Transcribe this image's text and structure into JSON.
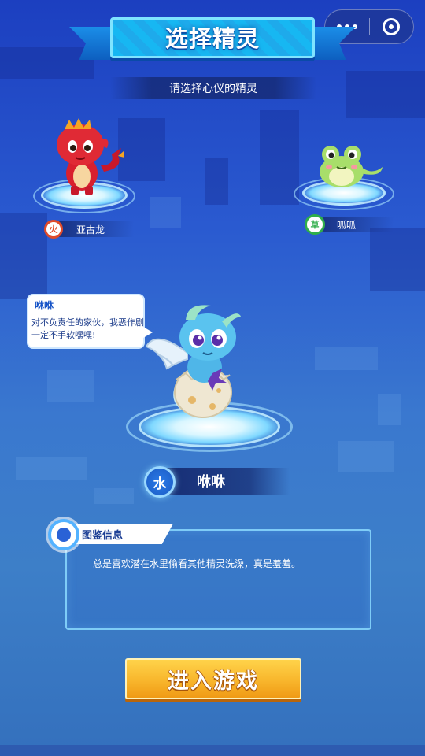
{
  "header": {
    "title": "选择精灵",
    "subtitle": "请选择心仪的精灵"
  },
  "capsule": {
    "more_icon": "more-dots-icon",
    "close_icon": "target-close-icon"
  },
  "spirits": {
    "left": {
      "name": "亚古龙",
      "element": "火",
      "element_color": "#e04a2a"
    },
    "right": {
      "name": "呱呱",
      "element": "草",
      "element_color": "#2fae4a"
    },
    "selected": {
      "name": "咻咻",
      "element": "水",
      "element_color": "#1f66d6"
    }
  },
  "bubble": {
    "name": "咻咻",
    "text": "对不负责任的家伙，我恶作剧一定不手软嘿嘿!"
  },
  "info_panel": {
    "tab_label": "图鉴信息",
    "description": "总是喜欢潜在水里偷看其他精灵洗澡，真是羞羞。"
  },
  "actions": {
    "enter_game_label": "进入游戏"
  },
  "colors": {
    "accent_blue": "#17b7f2",
    "button_yellow": "#f8b62c",
    "panel_border": "#8cdcff"
  }
}
